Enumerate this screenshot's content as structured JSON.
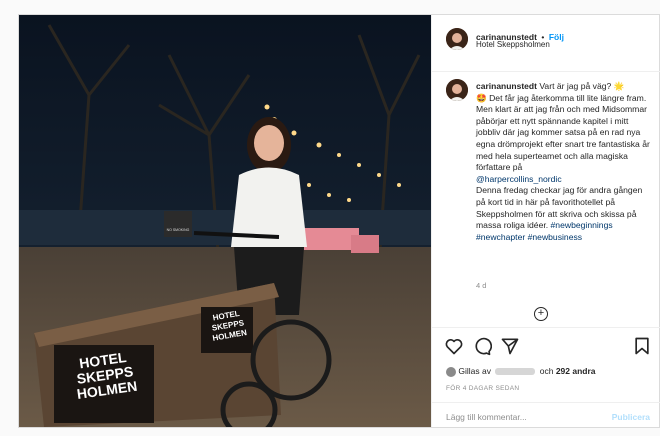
{
  "post": {
    "username": "carinanunstedt",
    "separator": "•",
    "follow_label": "Följ",
    "location": "Hotel Skeppsholmen",
    "photo": {
      "bike_text_lines": [
        "HOTEL",
        "SKEPPS",
        "HOLMEN"
      ],
      "bike_side_text_lines": [
        "HOTEL",
        "SKEPPS",
        "HOLMEN"
      ],
      "sign_text": "NO SMOKING"
    },
    "caption": {
      "username": "carinanunstedt",
      "p1": "Vart är jag på väg? 🌟",
      "p2": "🤩 Det får jag återkomma till lite längre fram. Men klart är att jag från och med Midsommar påbörjar ett nytt spännande kapitel i mitt jobbliv där jag kommer satsa på en rad nya egna drömprojekt efter snart tre fantastiska år med hela superteamet och alla magiska författare på",
      "mention": "@harpercollins_nordic",
      "p3": "Denna fredag checkar jag för andra gången på kort tid in här på favorithotellet på Skeppsholmen för att skriva och skissa på massa roliga idéer.",
      "tag1": "#newbeginnings",
      "tag2": "#newchapter",
      "tag3": "#newbusiness"
    },
    "time": "4 d",
    "likes_prefix": "Gillas av",
    "likes_conj": "och",
    "likes_count": "292 andra",
    "ago": "FÖR 4 DAGAR SEDAN",
    "comment_placeholder": "Lägg till kommentar...",
    "publish_label": "Publicera"
  },
  "icons": [
    "heart-icon",
    "comment-icon",
    "share-icon",
    "bookmark-icon",
    "more-icon"
  ],
  "colors": {
    "link": "#0095f6",
    "tag": "#00376b",
    "muted": "#8e8e8e",
    "publish": "#b2dffc"
  }
}
